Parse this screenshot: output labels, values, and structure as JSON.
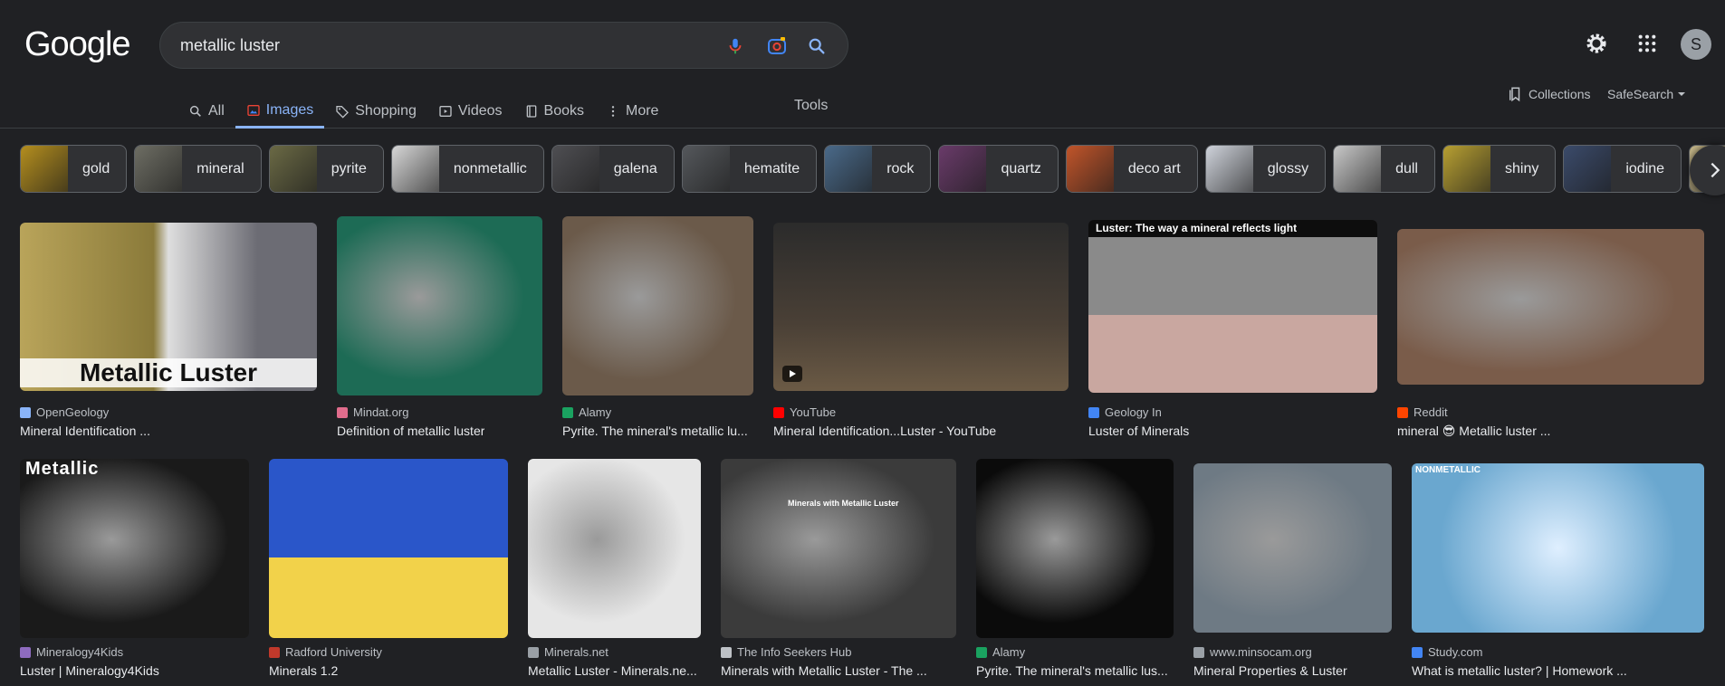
{
  "header": {
    "logo": "Google",
    "search_value": "metallic luster",
    "avatar_letter": "S"
  },
  "tabs": [
    {
      "label": "All",
      "icon": "search-icon"
    },
    {
      "label": "Images",
      "icon": "image-icon"
    },
    {
      "label": "Shopping",
      "icon": "tag-icon"
    },
    {
      "label": "Videos",
      "icon": "play-icon"
    },
    {
      "label": "Books",
      "icon": "book-icon"
    },
    {
      "label": "More",
      "icon": "more-vert-icon"
    }
  ],
  "tools_label": "Tools",
  "collections_label": "Collections",
  "safesearch_label": "SafeSearch",
  "chips": [
    {
      "label": "gold",
      "color": "#b58f1e"
    },
    {
      "label": "mineral",
      "color": "#6e6e64"
    },
    {
      "label": "pyrite",
      "color": "#6b6a45"
    },
    {
      "label": "nonmetallic",
      "color": "#d8d8d8"
    },
    {
      "label": "galena",
      "color": "#4f4f53"
    },
    {
      "label": "hematite",
      "color": "#55585c"
    },
    {
      "label": "rock",
      "color": "#4a6a8a"
    },
    {
      "label": "quartz",
      "color": "#6a3b6a"
    },
    {
      "label": "deco art",
      "color": "#c2552a"
    },
    {
      "label": "glossy",
      "color": "#d0d4dc"
    },
    {
      "label": "dull",
      "color": "#c9c9c9"
    },
    {
      "label": "shiny",
      "color": "#b8a032"
    },
    {
      "label": "iodine",
      "color": "#3b4b6b"
    },
    {
      "label": "",
      "color": "#c8b98a"
    }
  ],
  "results": [
    {
      "source": "OpenGeology",
      "title": "Mineral Identification ...",
      "overlay": "Metallic Luster",
      "fav": "#8ab4f8",
      "bg": "#eeeeee"
    },
    {
      "source": "Mindat.org",
      "title": "Definition of metallic luster",
      "overlay": "",
      "fav": "#e06c8c",
      "bg": "#1d6b55"
    },
    {
      "source": "Alamy",
      "title": "Pyrite. The mineral's metallic lu...",
      "overlay": "",
      "fav": "#1aa260",
      "bg": "#6b5a4a"
    },
    {
      "source": "YouTube",
      "title": "Mineral Identification...Luster - YouTube",
      "overlay": "",
      "fav": "#ff0000",
      "bg": "#2a2a2a"
    },
    {
      "source": "Geology In",
      "title": "Luster of Minerals",
      "overlay": "Luster: The way a mineral reflects light",
      "fav": "#4285f4",
      "bg": "#101010"
    },
    {
      "source": "Reddit",
      "title": "mineral 😎 Metallic luster ...",
      "overlay": "",
      "fav": "#ff4500",
      "bg": "#7a5c4a"
    },
    {
      "source": "Mineralogy4Kids",
      "title": "Luster | Mineralogy4Kids",
      "overlay": "Metallic",
      "fav": "#8e6bbf",
      "bg": "#1a1a1a"
    },
    {
      "source": "Radford University",
      "title": "Minerals 1.2",
      "overlay": "",
      "fav": "#c0392b",
      "bg": "#ffffff"
    },
    {
      "source": "Minerals.net",
      "title": "Metallic Luster - Minerals.ne...",
      "overlay": "",
      "fav": "#9aa0a6",
      "bg": "#e6e6e6"
    },
    {
      "source": "The Info Seekers Hub",
      "title": "Minerals with Metallic Luster - The ...",
      "overlay": "Minerals with Metallic Luster",
      "fav": "#bdc1c6",
      "bg": "#3b3b3b"
    },
    {
      "source": "Alamy",
      "title": "Pyrite. The mineral's metallic lus...",
      "overlay": "",
      "fav": "#1aa260",
      "bg": "#0b0b0b"
    },
    {
      "source": "www.minsocam.org",
      "title": "Mineral Properties & Luster",
      "overlay": "",
      "fav": "#9aa0a6",
      "bg": "#6e7a84"
    },
    {
      "source": "Study.com",
      "title": "What is metallic luster? | Homework ...",
      "overlay": "NONMETALLIC",
      "fav": "#4285f4",
      "bg": "#6aa7cf"
    }
  ]
}
